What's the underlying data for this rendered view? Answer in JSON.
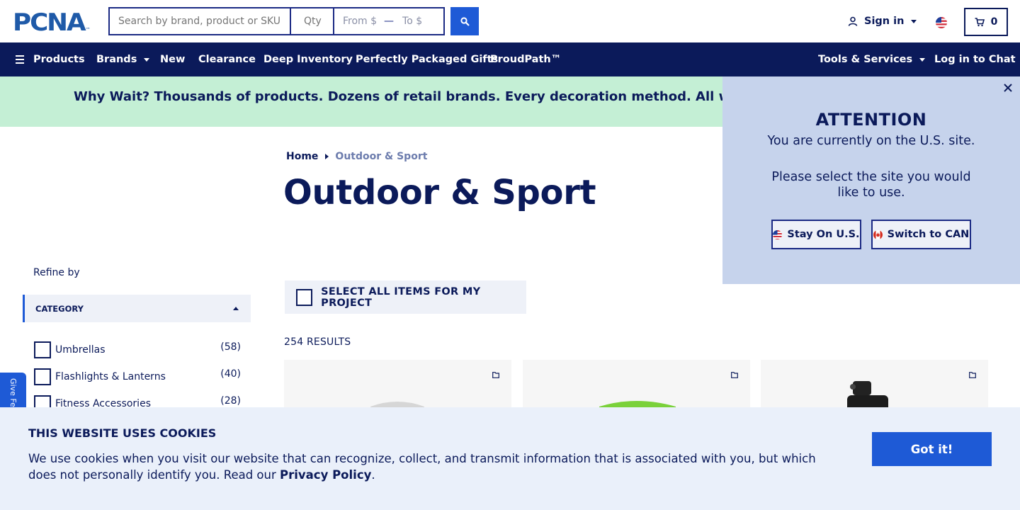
{
  "header": {
    "logo_text": "PCNA",
    "logo_tm": "™",
    "search_placeholder": "Search by brand, product or SKU",
    "qty_placeholder": "Qty",
    "price_from": "From $",
    "price_to": "To $",
    "sign_in": "Sign in",
    "cart_count": "0"
  },
  "nav": {
    "products": "Products",
    "brands": "Brands",
    "new": "New",
    "clearance": "Clearance",
    "deep_inventory": "Deep Inventory",
    "gifts": "Perfectly Packaged Gifts",
    "proudpath": "ProudPath™",
    "tools": "Tools & Services",
    "chat": "Log in to Chat"
  },
  "promo": {
    "text": "Why Wait? Thousands of products. Dozens of retail brands. Every decoration method. All with a standard"
  },
  "breadcrumb": {
    "home": "Home",
    "current": "Outdoor & Sport"
  },
  "page_title": "Outdoor & Sport",
  "filters": {
    "refine_label": "Refine by",
    "category_label": "CATEGORY",
    "items": [
      {
        "label": "Umbrellas",
        "count": "(58)"
      },
      {
        "label": "Flashlights & Lanterns",
        "count": "(40)"
      },
      {
        "label": "Fitness Accessories",
        "count": "(28)"
      }
    ]
  },
  "feedback_label": "Give Feedback",
  "select_all_label": "SELECT ALL ITEMS FOR MY PROJECT",
  "results_label": "254 RESULTS",
  "attention": {
    "title": "ATTENTION",
    "line1": "You are currently on the U.S. site.",
    "line2": "Please select the site you would like to use.",
    "stay_label": "Stay On U.S.",
    "switch_label": "Switch to CAN"
  },
  "cookie": {
    "title": "THIS WEBSITE USES COOKIES",
    "text": "We use cookies when you visit our website that can recognize, collect, and transmit information that is associated with you, but which does not personally identify you. Read our ",
    "link": "Privacy Policy",
    "end": ".",
    "button": "Got it!"
  },
  "colors": {
    "navy": "#0b1a5a",
    "accent_blue": "#1e5ad6",
    "promo_green": "#c4efd5",
    "popup_blue": "#c6d3ec"
  }
}
